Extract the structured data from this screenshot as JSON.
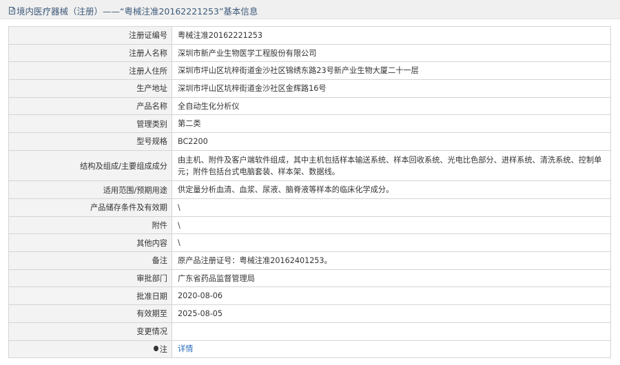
{
  "header": {
    "icon": "document-icon",
    "title": "境内医疗器械（注册）——“粤械注准20162221253”基本信息"
  },
  "rows": [
    {
      "label": "注册证编号",
      "value": "粤械注准20162221253"
    },
    {
      "label": "注册人名称",
      "value": "深圳市新产业生物医学工程股份有限公司"
    },
    {
      "label": "注册人住所",
      "value": "深圳市坪山区坑梓街道金沙社区锦绣东路23号新产业生物大厦二十一层"
    },
    {
      "label": "生产地址",
      "value": "深圳市坪山区坑梓街道金沙社区金辉路16号"
    },
    {
      "label": "产品名称",
      "value": "全自动生化分析仪"
    },
    {
      "label": "管理类别",
      "value": "第二类"
    },
    {
      "label": "型号规格",
      "value": "BC2200"
    },
    {
      "label": "结构及组成/主要组成成分",
      "value": "由主机、附件及客户端软件组成，其中主机包括样本输送系统、样本回收系统、光电比色部分、进样系统、清洗系统、控制单元；附件包括台式电脑套装、样本架、数据线。"
    },
    {
      "label": "适用范围/预期用途",
      "value": "供定量分析血清、血浆、尿液、脑脊液等样本的临床化学成分。"
    },
    {
      "label": "产品储存条件及有效期",
      "value": "\\"
    },
    {
      "label": "附件",
      "value": "\\"
    },
    {
      "label": "其他内容",
      "value": "\\"
    },
    {
      "label": "备注",
      "value": "原产品注册证号：粤械注准20162401253。"
    },
    {
      "label": "审批部门",
      "value": "广东省药品监督管理局"
    },
    {
      "label": "批准日期",
      "value": "2020-08-06"
    },
    {
      "label": "有效期至",
      "value": "2025-08-05"
    },
    {
      "label": "变更情况",
      "value": ""
    }
  ],
  "note_row": {
    "icon": "pin-icon",
    "label": "注",
    "link_text": "详情"
  },
  "colors": {
    "header_bg": "#f0f0f0",
    "header_text": "#3d5a7a",
    "label_bg": "#f3f3f3",
    "border": "#d4d4d4",
    "link": "#2a6dc0"
  }
}
